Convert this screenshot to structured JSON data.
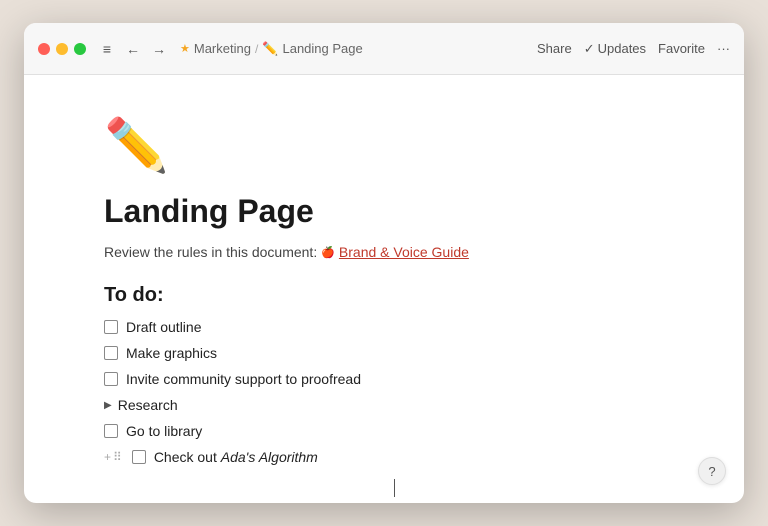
{
  "window": {
    "title": "Landing Page"
  },
  "titlebar": {
    "traffic_lights": [
      "red",
      "yellow",
      "green"
    ],
    "hamburger_label": "≡",
    "back_label": "←",
    "forward_label": "→",
    "breadcrumbs": [
      {
        "label": "Marketing",
        "icon": "star"
      },
      {
        "label": "Landing Page",
        "icon": "pencil"
      }
    ],
    "actions": {
      "share": "Share",
      "updates_check": "✓",
      "updates": "Updates",
      "favorite": "Favorite",
      "more": "···"
    }
  },
  "page": {
    "icon": "✏️",
    "title": "Landing Page",
    "subtitle_text": "Review the rules in this document:",
    "subtitle_link": "Brand & Voice Guide",
    "section_heading": "To do:",
    "todo_items": [
      {
        "text": "Draft outline",
        "checked": false
      },
      {
        "text": "Make graphics",
        "checked": false
      },
      {
        "text": "Invite community support to proofread",
        "checked": false
      },
      {
        "text": "Research",
        "type": "toggle"
      },
      {
        "text": "Go to library",
        "checked": false
      },
      {
        "text": "Check out ",
        "italic": "Ada's Algorithm",
        "checked": false,
        "has_controls": true
      }
    ]
  },
  "help": {
    "label": "?"
  }
}
